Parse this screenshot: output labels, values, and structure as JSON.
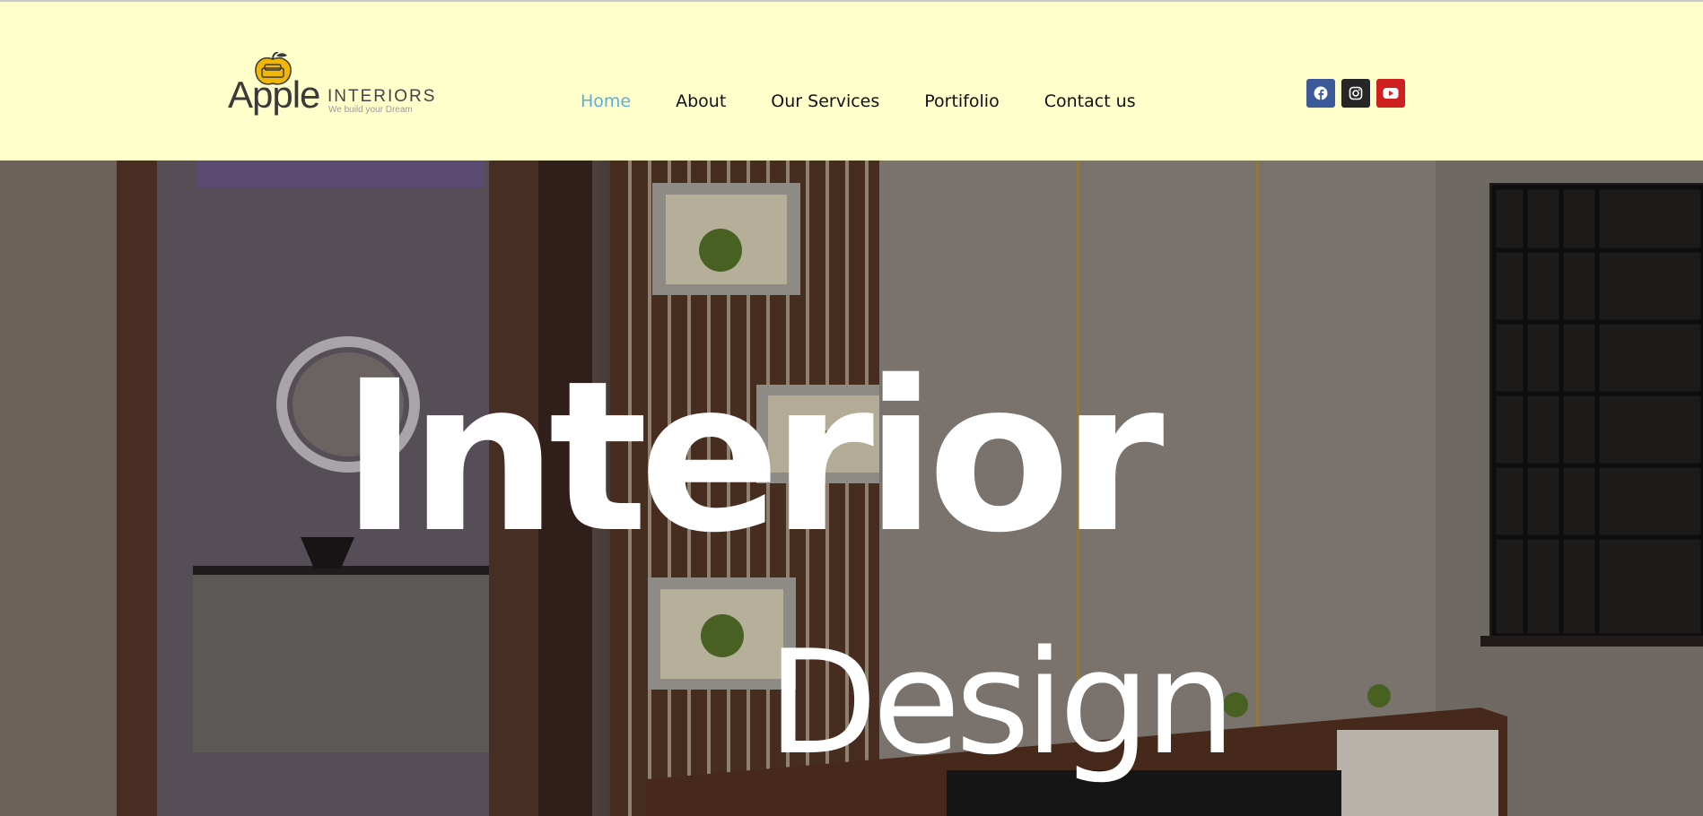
{
  "header": {
    "logo": {
      "brand": "Apple",
      "sub": "INTERIORS",
      "tagline": "We build your Dream"
    },
    "nav": [
      {
        "label": "Home",
        "active": true
      },
      {
        "label": "About",
        "active": false
      },
      {
        "label": "Our Services",
        "active": false
      },
      {
        "label": "Portifolio",
        "active": false
      },
      {
        "label": "Contact us",
        "active": false
      }
    ],
    "social": [
      {
        "icon": "facebook-icon",
        "color": "#3b5998"
      },
      {
        "icon": "instagram-icon",
        "color": "#262626"
      },
      {
        "icon": "youtube-icon",
        "color": "#cd201f"
      }
    ]
  },
  "hero": {
    "line1": "Interior",
    "line2": "Design"
  },
  "colors": {
    "header_bg": "#ffffcc",
    "nav_active": "#5aaee0",
    "nav_text": "#111111",
    "logo_accent": "#f2b705"
  }
}
